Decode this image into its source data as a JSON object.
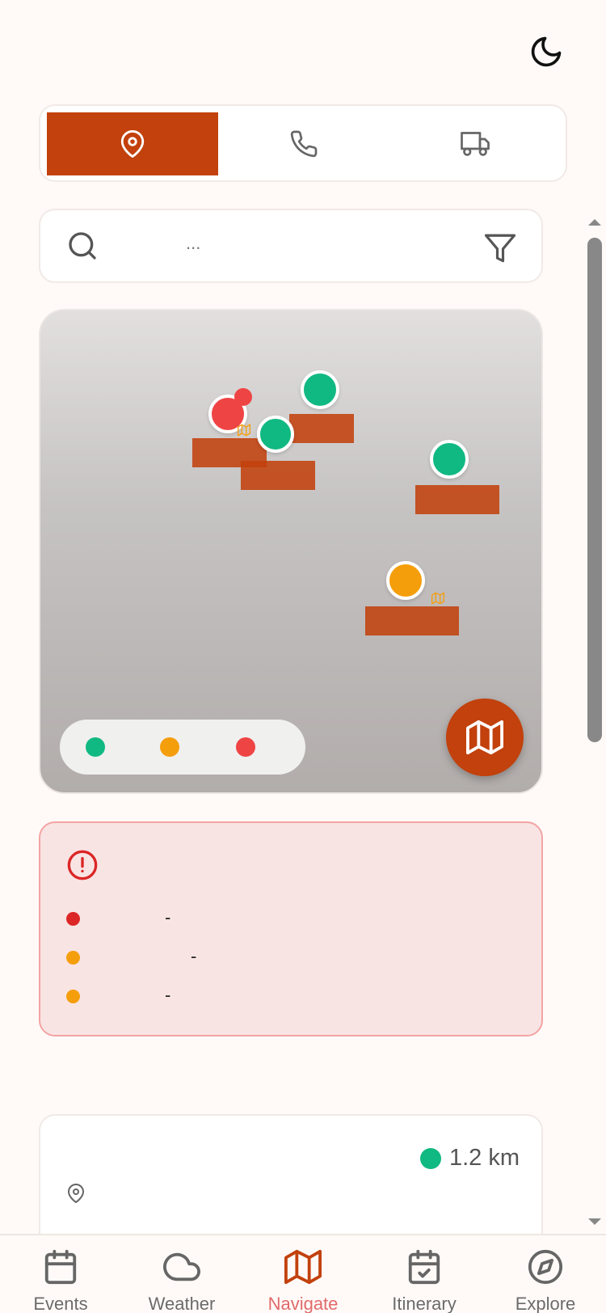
{
  "header": {
    "theme_toggle_icon": "moon-icon"
  },
  "segment_tabs": [
    {
      "icon": "map-pin-icon",
      "active": true
    },
    {
      "icon": "phone-icon",
      "active": false
    },
    {
      "icon": "truck-icon",
      "active": false
    }
  ],
  "search": {
    "placeholder": "...",
    "search_icon": "search-icon",
    "filter_icon": "filter-icon"
  },
  "map": {
    "legend": [
      {
        "color": "#10b981"
      },
      {
        "color": "#f59e0b"
      },
      {
        "color": "#ef4444"
      }
    ],
    "fab_icon": "map-icon"
  },
  "alert": {
    "icon": "alert-circle-icon",
    "rows": [
      {
        "color": "#dc2626",
        "text": "-"
      },
      {
        "color": "#f59e0b",
        "text": "-"
      },
      {
        "color": "#f59e0b",
        "text": "-"
      }
    ]
  },
  "card": {
    "distance": "1.2 km",
    "status_color": "#10b981",
    "pin_icon": "map-pin-icon"
  },
  "bottom_nav": [
    {
      "label": "Events",
      "icon": "calendar-icon",
      "active": false
    },
    {
      "label": "Weather",
      "icon": "cloud-icon",
      "active": false
    },
    {
      "label": "Navigate",
      "icon": "map-icon",
      "active": true
    },
    {
      "label": "Itinerary",
      "icon": "calendar-check-icon",
      "active": false
    },
    {
      "label": "Explore",
      "icon": "compass-icon",
      "active": false
    }
  ],
  "colors": {
    "accent": "#c2410c",
    "background": "#fffaf8"
  }
}
